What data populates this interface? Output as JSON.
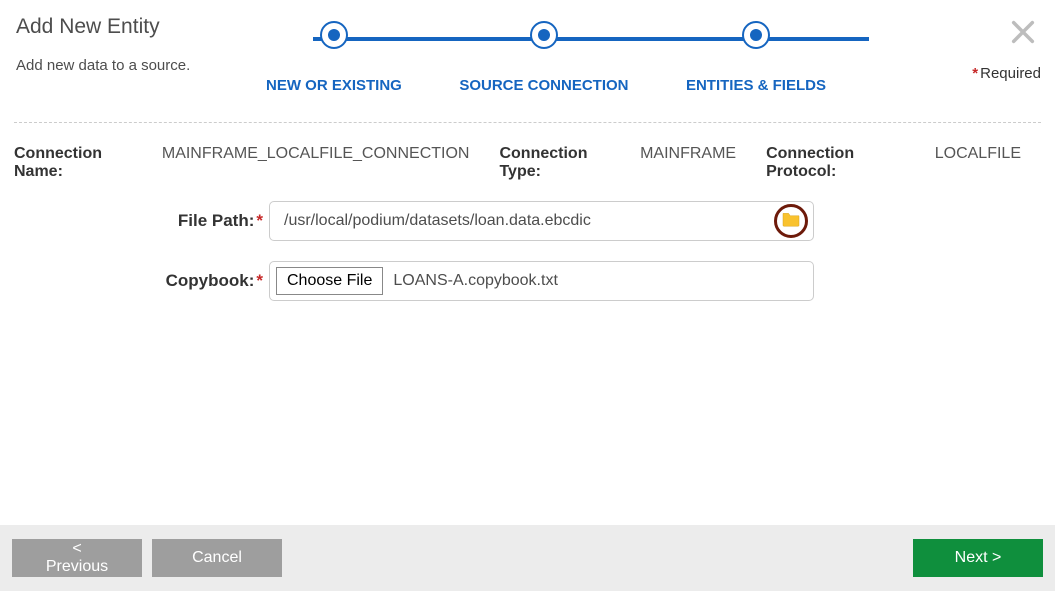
{
  "header": {
    "title": "Add New Entity",
    "subtitle": "Add new data to a source.",
    "required_label": "Required"
  },
  "stepper": {
    "steps": [
      "NEW OR EXISTING",
      "SOURCE CONNECTION",
      "ENTITIES & FIELDS"
    ]
  },
  "info": {
    "conn_name_label": "Connection Name:",
    "conn_name_value": "MAINFRAME_LOCALFILE_CONNECTION",
    "conn_type_label": "Connection Type:",
    "conn_type_value": "MAINFRAME",
    "conn_proto_label": "Connection Protocol:",
    "conn_proto_value": "LOCALFILE"
  },
  "form": {
    "filepath_label": "File Path:",
    "filepath_value": "/usr/local/podium/datasets/loan.data.ebcdic",
    "copybook_label": "Copybook:",
    "choose_file_label": "Choose File",
    "copybook_filename": "LOANS-A.copybook.txt"
  },
  "footer": {
    "previous": "< Previous",
    "cancel": "Cancel",
    "next": "Next >"
  }
}
